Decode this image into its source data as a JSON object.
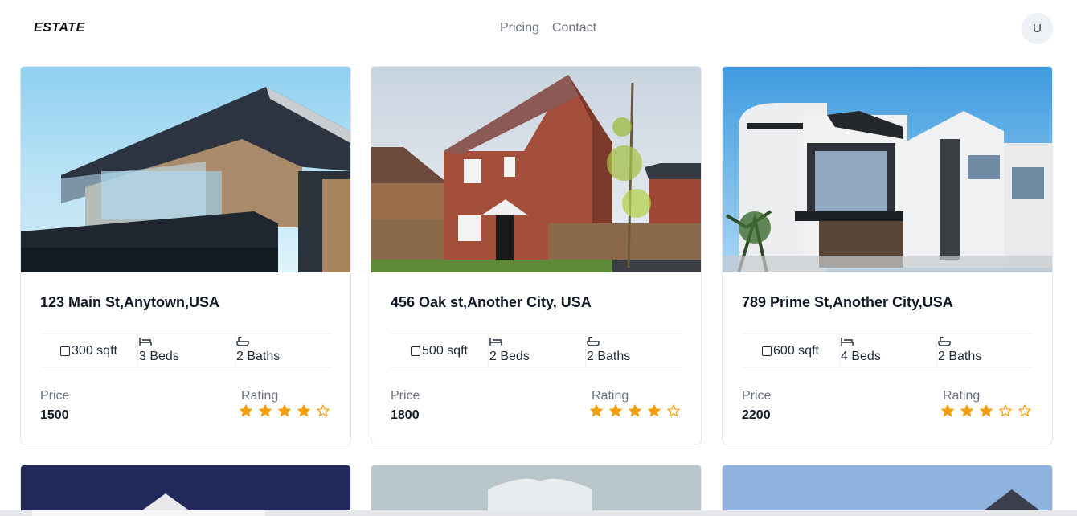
{
  "header": {
    "brand": "ESTATE",
    "nav": [
      "Pricing",
      "Contact"
    ],
    "avatar_initial": "U"
  },
  "listings": [
    {
      "address": "123 Main St,Anytown,USA",
      "sqft": "300 sqft",
      "beds": "3 Beds",
      "baths": "2 Baths",
      "price_label": "Price",
      "price": "1500",
      "rating_label": "Rating",
      "rating": 4,
      "rating_max": 5
    },
    {
      "address": "456 Oak st,Another City, USA",
      "sqft": "500 sqft",
      "beds": "2 Beds",
      "baths": "2 Baths",
      "price_label": "Price",
      "price": "1800",
      "rating_label": "Rating",
      "rating": 4,
      "rating_max": 5
    },
    {
      "address": "789 Prime St,Another City,USA",
      "sqft": "600 sqft",
      "beds": "4 Beds",
      "baths": "2 Baths",
      "price_label": "Price",
      "price": "2200",
      "rating_label": "Rating",
      "rating": 3,
      "rating_max": 5
    }
  ],
  "colors": {
    "star_filled": "#f59e0b",
    "muted_text": "#6b7280",
    "border": "#e5e7eb"
  },
  "icons": [
    "square-area-icon",
    "bed-icon",
    "bath-icon",
    "star-icon",
    "star-outline-icon"
  ]
}
